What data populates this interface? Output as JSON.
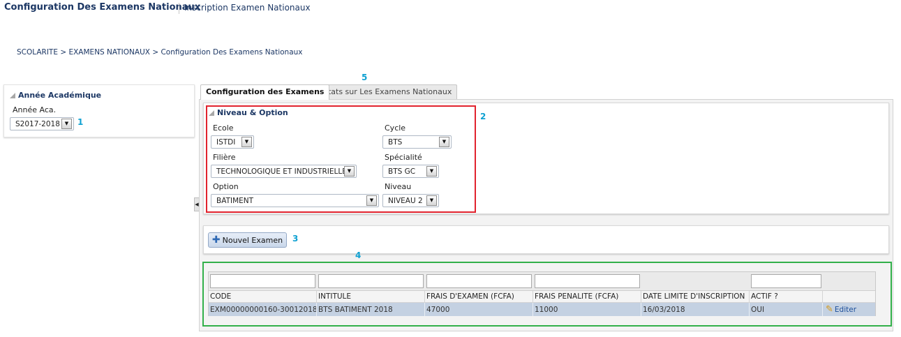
{
  "header": {
    "title": "Configuration Des Examens Nationaux",
    "link": "Inscription Examen Nationaux"
  },
  "breadcrumb": {
    "items": [
      "SCOLARITE",
      "EXAMENS NATIONAUX",
      "Configuration Des Examens Nationaux"
    ],
    "separator": ">"
  },
  "academic_year_panel": {
    "title": "Année Académique",
    "label": "Année Aca.",
    "selected": "S2017-2018"
  },
  "tabs": [
    {
      "label": "Configuration des Examens",
      "active": true
    },
    {
      "label": "Etats sur Les Examens Nationaux",
      "active": false
    }
  ],
  "niveau_option": {
    "title": "Niveau & Option",
    "fields": {
      "ecole": {
        "label": "Ecole",
        "value": "ISTDI"
      },
      "cycle": {
        "label": "Cycle",
        "value": "BTS"
      },
      "filiere": {
        "label": "Filière",
        "value": "TECHNOLOGIQUE ET INDUSTRIELLE"
      },
      "specialite": {
        "label": "Spécialité",
        "value": "BTS GC"
      },
      "option": {
        "label": "Option",
        "value": "BÂTIMENT"
      },
      "niveau": {
        "label": "Niveau",
        "value": "NIVEAU 2"
      }
    }
  },
  "actions": {
    "new_exam_label": "Nouvel Examen",
    "new_exam_icon": "plus-icon"
  },
  "table": {
    "columns": [
      "CODE",
      "INTITULE",
      "FRAIS D'EXAMEN (FCFA)",
      "FRAIS PENALITE (FCFA)",
      "DATE LIMITE D'INSCRIPTION",
      "ACTIF ?"
    ],
    "rows": [
      {
        "code": "EXM00000000160-30012018",
        "intitule": "BTS BATIMENT 2018",
        "frais_examen": "47000",
        "frais_penalite": "11000",
        "date_limite": "16/03/2018",
        "actif": "OUI"
      }
    ],
    "edit_label": "Editer",
    "edit_icon": "pencil-icon"
  },
  "annotations": {
    "m1": "1",
    "m2": "2",
    "m3": "3",
    "m4": "4",
    "m5": "5"
  },
  "colors": {
    "title_blue": "#1c3764",
    "marker_cyan": "#0fa1d2",
    "red_frame": "#e1222d",
    "green_frame": "#32b04a",
    "selected_row": "#c4d1e2"
  }
}
